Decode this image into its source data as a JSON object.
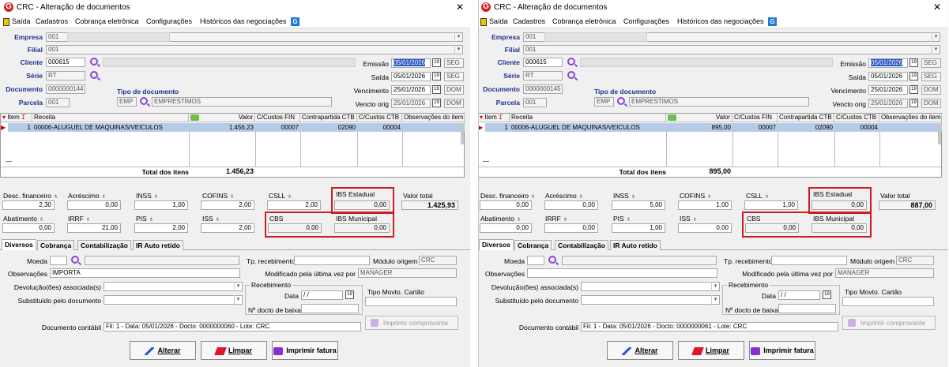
{
  "window": {
    "title": "CRC - Alteração de documentos",
    "close": "✕"
  },
  "menu": {
    "saida": "Saída",
    "cadastros": "Cadastros",
    "cobranca": "Cobrança eletrônica",
    "config": "Configurações",
    "historicos": "Históricos das negociações"
  },
  "labels": {
    "empresa": "Empresa",
    "filial": "Filial",
    "cliente": "Cliente",
    "serie": "Série",
    "documento": "Documento",
    "parcela": "Parcela",
    "tipo_doc": "Tipo de documento",
    "emissao": "Emissão",
    "saida": "Saída",
    "vencimento": "Vencimento",
    "vencto_orig": "Vencto orig",
    "desc_fin": "Desc. financeiro",
    "acrescimo": "Acréscimo",
    "inss": "INSS",
    "cofins": "COFINS",
    "csll": "CSLL",
    "ibs_estadual": "IBS Estadual",
    "valor_total": "Valor total",
    "abatimento": "Abatimento",
    "irrf": "IRRF",
    "pis": "PIS",
    "iss": "ISS",
    "cbs": "CBS",
    "ibs_municipal": "IBS Municipal",
    "moeda": "Moeda",
    "observacoes": "Observações",
    "devolucoes": "Devolução(ões) associada(s)",
    "substituido": "Substituído pelo documento",
    "tp_receb": "Tp. recebimento",
    "modulo_origem": "Módulo origem",
    "modificado": "Modificado pela última vez por",
    "recebimento": "Recebimento",
    "data": "Data",
    "n_docto_baixa": "Nº docto de baixa",
    "tipo_movto": "Tipo Movto. Cartão",
    "doc_contabil": "Documento contábil",
    "total_itens": "Total dos itens"
  },
  "grid_headers": {
    "item": "Item",
    "receita": "Receita",
    "valor": "Valor",
    "ccfin": "C/Custos FIN",
    "contra": "Contrapartida CTB",
    "ccctb": "C/Custos CTB",
    "obs": "Observações do item"
  },
  "tabs": {
    "diversos": "Diversos",
    "cobranca": "Cobrança",
    "contabilizacao": "Contabilização",
    "ir": "IR Auto retido"
  },
  "buttons": {
    "alterar": "Alterar",
    "limpar": "Limpar",
    "imprimir": "Imprimir fatura",
    "comprovante": "Imprimir comprovante"
  },
  "docs": [
    {
      "empresa": "001",
      "filial": "001",
      "cliente": "000615",
      "serie": "RT",
      "documento": "0000000144",
      "parcela": "001",
      "tipo_cod": "EMP",
      "tipo_desc": "EMPRESTIMOS",
      "emissao": "05/01/2026",
      "emissao_dia": "SEG",
      "saida": "05/01/2026",
      "saida_dia": "SEG",
      "vencimento": "25/01/2026",
      "venc_dia": "DOM",
      "vencto_orig": "25/01/2026",
      "vorig_dia": "DOM",
      "item_num": "1",
      "item_receita": "00006-ALUGUEL DE MAQUINAS/VEICULOS",
      "item_valor": "1.456,23",
      "item_ccfin": "00007",
      "item_contra": "02090",
      "item_ccctb": "00004",
      "total_itens": "1.456,23",
      "desc_fin": "2,30",
      "acrescimo": "0,00",
      "inss": "1,00",
      "cofins": "2,00",
      "csll": "2,00",
      "ibs_estadual": "0,00",
      "valor_total": "1.425,93",
      "abatimento": "0,00",
      "irrf": "21,00",
      "pis": "2,00",
      "iss": "2,00",
      "cbs": "0,00",
      "ibs_municipal": "0,00",
      "observacoes": "IMPORTA",
      "modulo_origem": "CRC",
      "modificado": "MANAGER",
      "data": "/ /",
      "doc_contabil": "Fil: 1 - Data: 05/01/2026 - Docto: 0000000060 - Lote: CRC"
    },
    {
      "empresa": "001",
      "filial": "001",
      "cliente": "000615",
      "serie": "RT",
      "documento": "0000000145",
      "parcela": "001",
      "tipo_cod": "EMP",
      "tipo_desc": "EMPRESTIMOS",
      "emissao": "05/01/2026",
      "emissao_dia": "SEG",
      "saida": "05/01/2026",
      "saida_dia": "SEG",
      "vencimento": "25/01/2026",
      "venc_dia": "DOM",
      "vencto_orig": "25/01/2026",
      "vorig_dia": "DOM",
      "item_num": "1",
      "item_receita": "00006-ALUGUEL DE MAQUINAS/VEICULOS",
      "item_valor": "895,00",
      "item_ccfin": "00007",
      "item_contra": "02090",
      "item_ccctb": "00004",
      "total_itens": "895,00",
      "desc_fin": "0,00",
      "acrescimo": "0,00",
      "inss": "5,00",
      "cofins": "1,00",
      "csll": "1,00",
      "ibs_estadual": "0,00",
      "valor_total": "887,00",
      "abatimento": "0,00",
      "irrf": "0,00",
      "pis": "1,00",
      "iss": "0,00",
      "cbs": "0,00",
      "ibs_municipal": "0,00",
      "observacoes": "",
      "modulo_origem": "CRC",
      "modificado": "MANAGER",
      "data": "/ /",
      "doc_contabil": "Fil: 1 - Data: 05/01/2026 - Docto: 0000000061 - Lote: CRC"
    }
  ]
}
